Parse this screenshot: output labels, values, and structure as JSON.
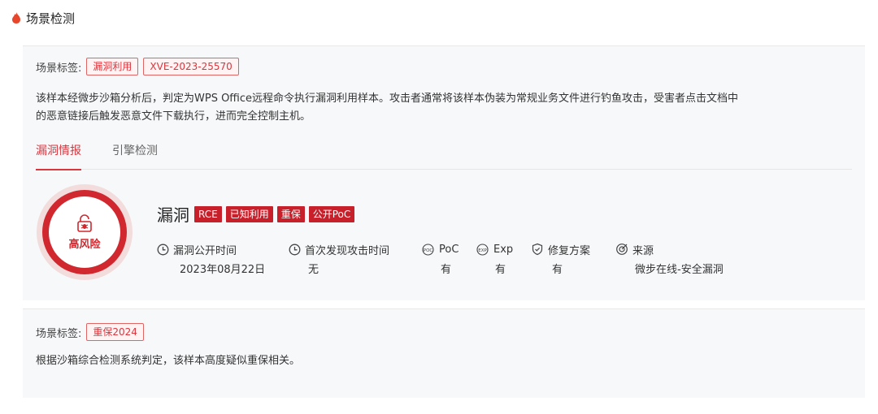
{
  "section": {
    "title": "场景检测",
    "icon": "fire-icon"
  },
  "card1": {
    "tags_label": "场景标签:",
    "tags": [
      "漏洞利用",
      "XVE-2023-25570"
    ],
    "desc_lines": [
      "该样本经微步沙箱分析后，判定为WPS Office远程命令执行漏洞利用样本。攻击者通常将该样本伪装为常规业务文件进行钓鱼攻击，受害者点击文档中",
      "的恶意链接后触发恶意文件下载执行，进而完全控制主机。"
    ],
    "tabs": [
      {
        "label": "漏洞情报",
        "active": true
      },
      {
        "label": "引擎检测",
        "active": false
      }
    ],
    "risk": {
      "label": "高风险",
      "icon": "bug-lock-icon"
    },
    "vuln": {
      "name": "漏洞",
      "tags": [
        "RCE",
        "已知利用",
        "重保",
        "公开PoC"
      ]
    },
    "meta": [
      {
        "key": "漏洞公开时间",
        "value": "2023年08月22日",
        "icon": "clock-icon"
      },
      {
        "key": "首次发现攻击时间",
        "value": "无",
        "icon": "clock-icon"
      },
      {
        "key": "PoC",
        "value": "有",
        "icon": "poc-icon"
      },
      {
        "key": "Exp",
        "value": "有",
        "icon": "exp-icon"
      },
      {
        "key": "修复方案",
        "value": "有",
        "icon": "shield-check-icon"
      },
      {
        "key": "来源",
        "value": "微步在线-安全漏洞",
        "icon": "target-icon"
      }
    ]
  },
  "card2": {
    "tags_label": "场景标签:",
    "tags": [
      "重保2024"
    ],
    "desc": "根据沙箱综合检测系统判定，该样本高度疑似重保相关。"
  },
  "colors": {
    "accent": "#d9363e",
    "tag_bg": "#c8202a",
    "card_bg": "#f7f8fa"
  }
}
